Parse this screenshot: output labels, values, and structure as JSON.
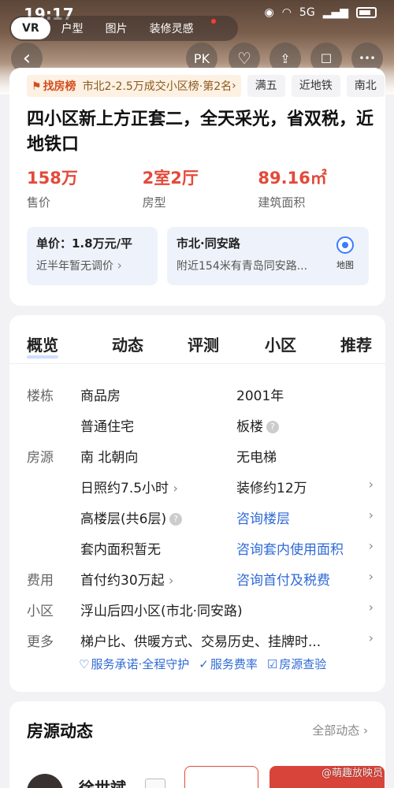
{
  "status": {
    "time": "19:17",
    "network": "5G",
    "battery": ""
  },
  "media_tabs": [
    "VR",
    "户型",
    "图片",
    "装修灵感"
  ],
  "topbar": {
    "back": "‹",
    "pk": "PK",
    "favorite": "♡",
    "share": "⇪",
    "comment": "☐",
    "more": "•••"
  },
  "ranking": {
    "title": "找房榜",
    "text": "市北2-2.5万成交小区榜·第2名",
    "arrow": "›",
    "chips": [
      "满五",
      "近地铁",
      "南北"
    ]
  },
  "listing": {
    "title": "四小区新上方正套二，全天采光，省双税，近地铁口",
    "price": {
      "value": "158万",
      "label": "售价"
    },
    "layout": {
      "value": "2室2厅",
      "label": "房型"
    },
    "area": {
      "value": "89.16㎡",
      "label": "建筑面积"
    },
    "unit_price": {
      "title": "单价：1.8万元/平",
      "desc": "近半年暂无调价"
    },
    "location": {
      "title": "市北·同安路",
      "desc": "附近154米有青岛同安路...",
      "map_label": "地图"
    }
  },
  "tabs": [
    "概览",
    "动态",
    "评测",
    "小区",
    "推荐"
  ],
  "overview": {
    "building": {
      "label": "楼栋",
      "type": "商品房",
      "year": "2001年",
      "usage": "普通住宅",
      "structure": "板楼"
    },
    "house": {
      "label": "房源",
      "orientation": "南 北朝向",
      "elevator": "无电梯",
      "sunlight": "日照约7.5小时",
      "renovation": "装修约12万",
      "floor": "高楼层(共6层)",
      "floor_link": "咨询楼层",
      "inner_area": "套内面积暂无",
      "inner_area_link": "咨询套内使用面积"
    },
    "cost": {
      "label": "费用",
      "down_payment": "首付约30万起",
      "link": "咨询首付及税费"
    },
    "community": {
      "label": "小区",
      "value": "浮山后四小区(市北·同安路)"
    },
    "more": {
      "label": "更多",
      "value": "梯户比、供暖方式、交易历史、挂牌时..."
    },
    "services": [
      "服务承诺·全程守护",
      "服务费率",
      "房源查验"
    ]
  },
  "dynamics": {
    "title": "房源动态",
    "all_link": "全部动态 ›"
  },
  "agent": {
    "name": "徐世斌"
  },
  "watermark": "@萌趣放映员"
}
